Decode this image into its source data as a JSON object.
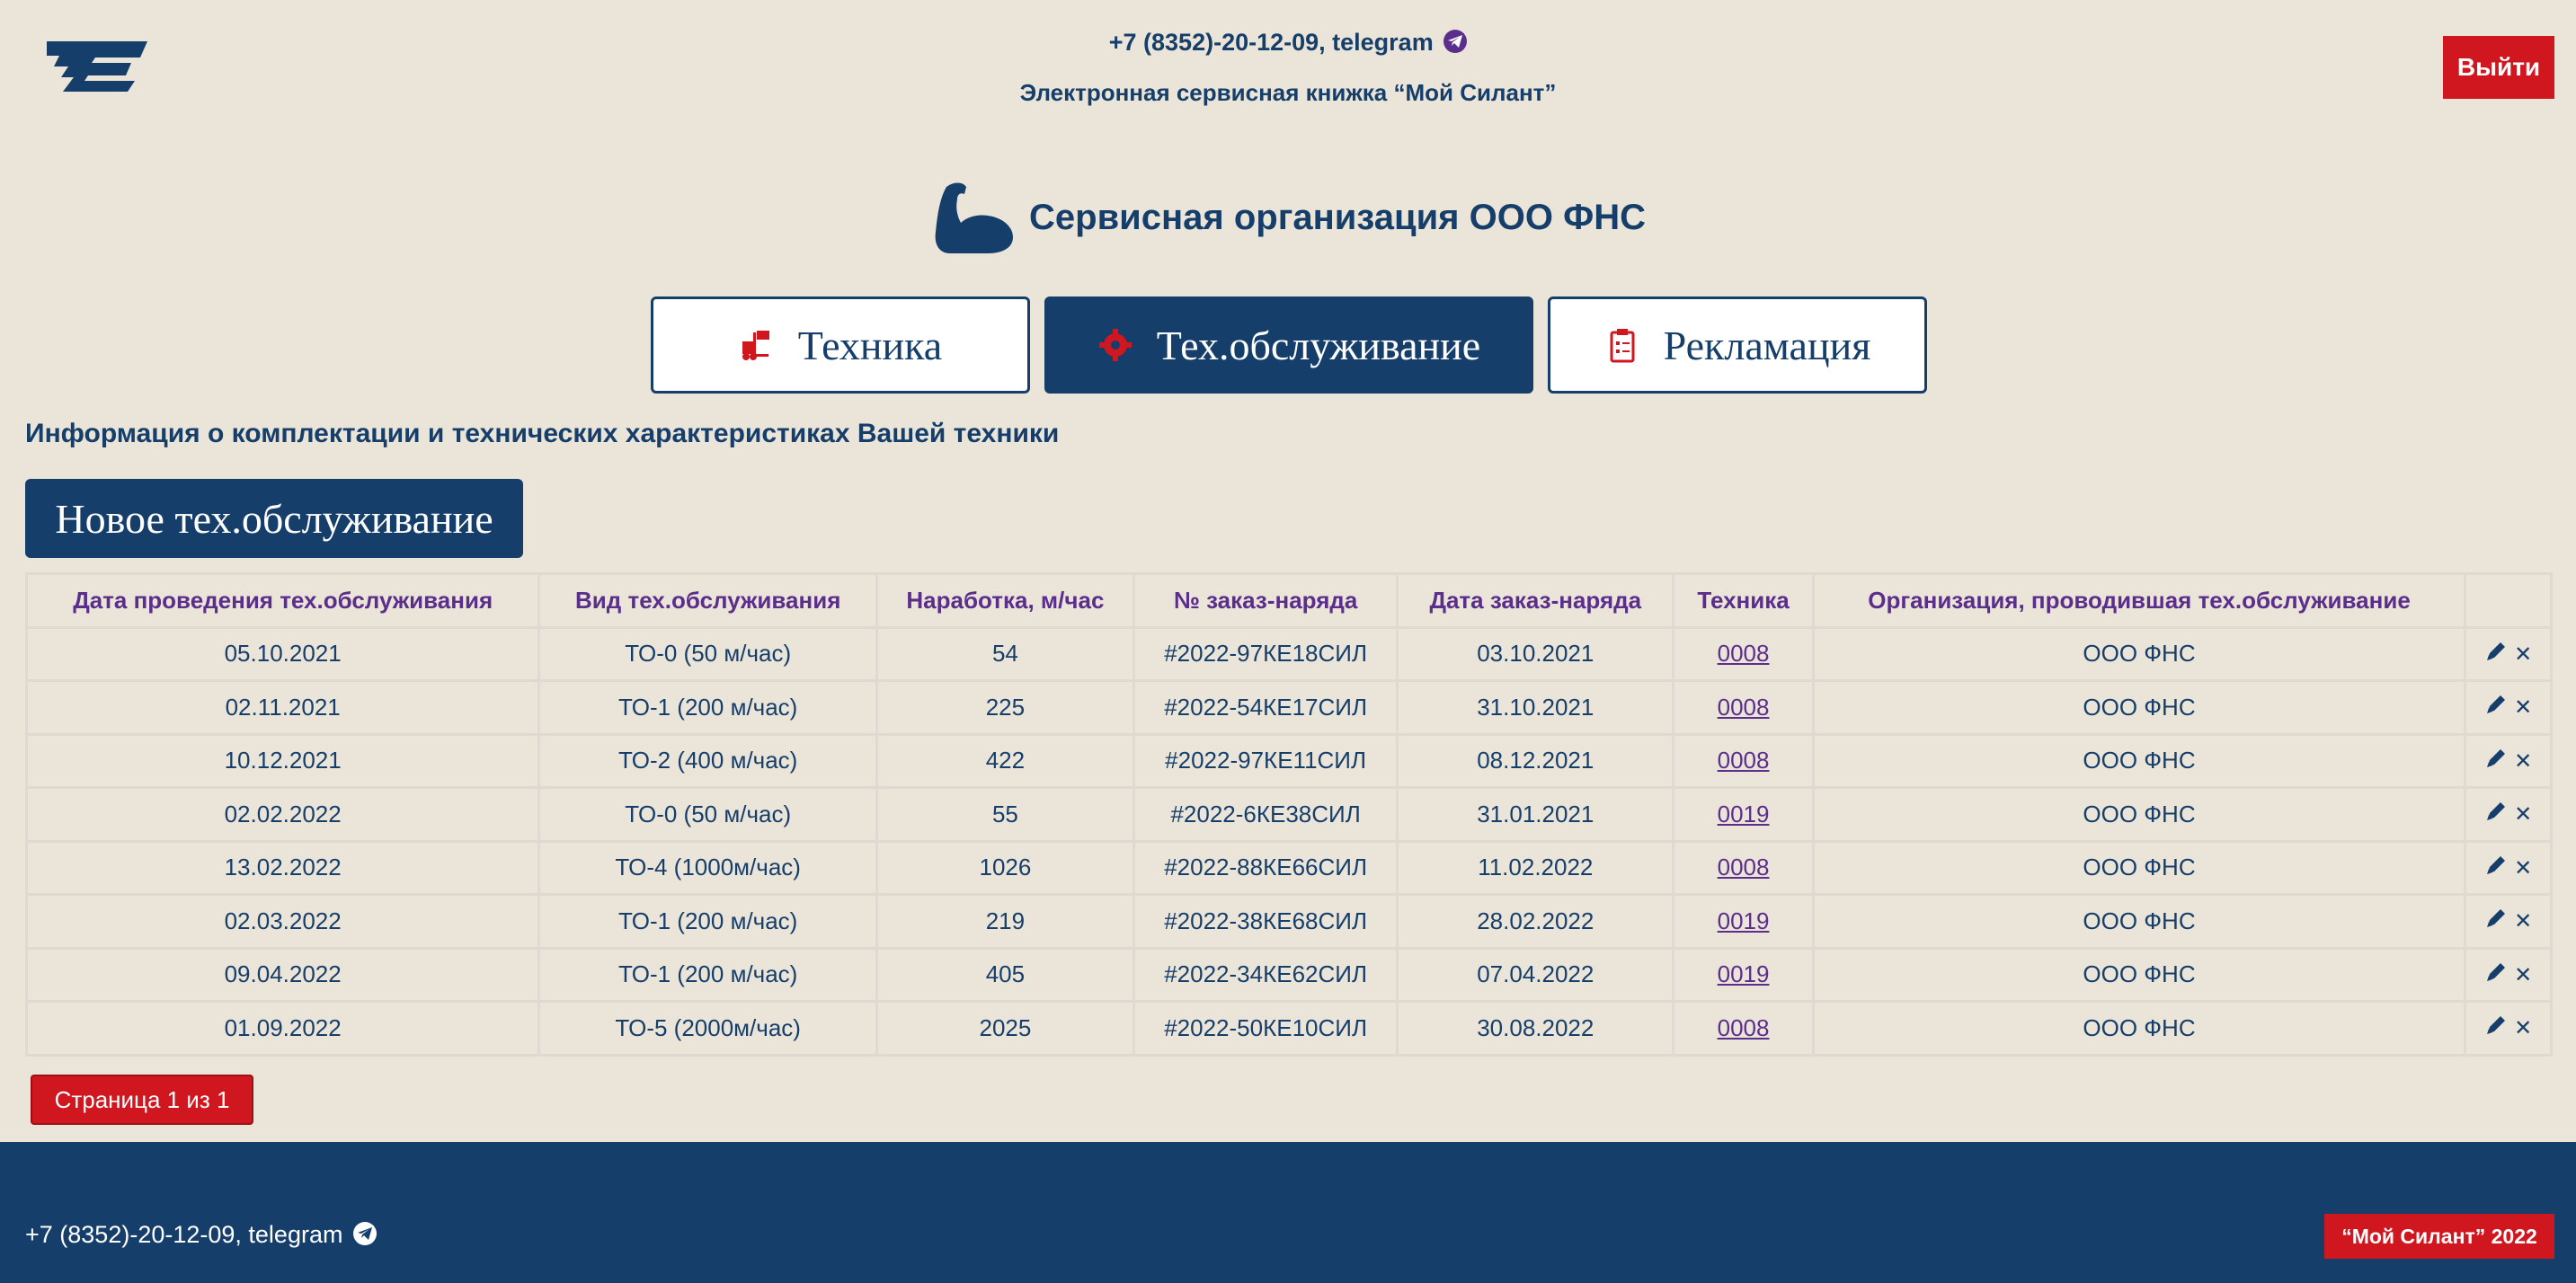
{
  "header": {
    "contacts": "+7 (8352)-20-12-09, telegram",
    "subtitle": "Электронная сервисная книжка “Мой Силант”",
    "logout_label": "Выйти"
  },
  "org": {
    "title": "Сервисная организация ООО ФНС"
  },
  "tabs": [
    {
      "label": "Техника",
      "icon": "forklift-icon"
    },
    {
      "label": "Тех.обслуживание",
      "icon": "gear-icon"
    },
    {
      "label": "Рекламация",
      "icon": "clipboard-icon"
    }
  ],
  "info_text": "Информация о комплектации и технических характеристиках Вашей техники",
  "new_button": "Новое тех.обслуживание",
  "table": {
    "headers": [
      "Дата проведения тех.обслуживания",
      "Вид тех.обслуживания",
      "Наработка, м/час",
      "№ заказ-наряда",
      "Дата заказ-наряда",
      "Техника",
      "Организация, проводившая тех.обслуживание",
      ""
    ],
    "rows": [
      [
        "05.10.2021",
        "ТО-0 (50 м/час)",
        "54",
        "#2022-97КЕ18СИЛ",
        "03.10.2021",
        "0008",
        "ООО ФНС"
      ],
      [
        "02.11.2021",
        "ТО-1 (200 м/час)",
        "225",
        "#2022-54КЕ17СИЛ",
        "31.10.2021",
        "0008",
        "ООО ФНС"
      ],
      [
        "10.12.2021",
        "ТО-2 (400 м/час)",
        "422",
        "#2022-97КЕ11СИЛ",
        "08.12.2021",
        "0008",
        "ООО ФНС"
      ],
      [
        "02.02.2022",
        "ТО-0 (50 м/час)",
        "55",
        "#2022-6КЕ38СИЛ",
        "31.01.2021",
        "0019",
        "ООО ФНС"
      ],
      [
        "13.02.2022",
        "ТО-4 (1000м/час)",
        "1026",
        "#2022-88КЕ66СИЛ",
        "11.02.2022",
        "0008",
        "ООО ФНС"
      ],
      [
        "02.03.2022",
        "ТО-1 (200 м/час)",
        "219",
        "#2022-38КЕ68СИЛ",
        "28.02.2022",
        "0019",
        "ООО ФНС"
      ],
      [
        "09.04.2022",
        "ТО-1 (200 м/час)",
        "405",
        "#2022-34КЕ62СИЛ",
        "07.04.2022",
        "0019",
        "ООО ФНС"
      ],
      [
        "01.09.2022",
        "ТО-5 (2000м/час)",
        "2025",
        "#2022-50КЕ10СИЛ",
        "30.08.2022",
        "0008",
        "ООО ФНС"
      ]
    ],
    "edit_icon": "pencil-icon",
    "delete_glyph": "✕"
  },
  "pager": {
    "label": "Страница 1 из 1"
  },
  "footer": {
    "contacts": "+7 (8352)-20-12-09, telegram",
    "badge": "“Мой Силант” 2022"
  },
  "colors": {
    "primary": "#163e6a",
    "accent": "#d0161f",
    "purple": "#5b2e8c",
    "background": "#ebe5d9"
  }
}
